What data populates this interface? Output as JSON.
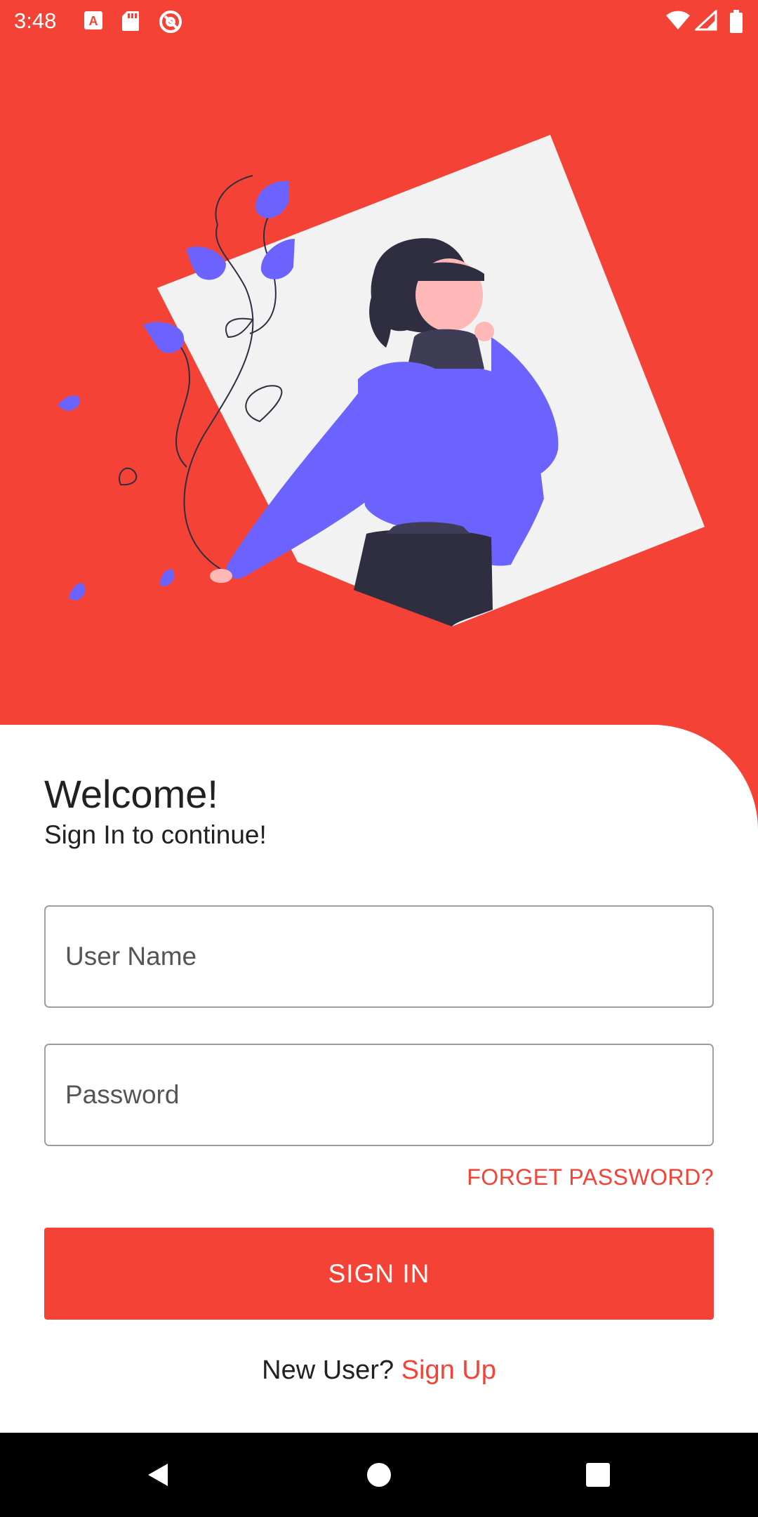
{
  "status_bar": {
    "time": "3:48",
    "left_icons": [
      "a-badge-icon",
      "sd-card-icon",
      "at-sign-icon"
    ],
    "right_icons": [
      "wifi-icon",
      "signal-icon",
      "battery-icon"
    ]
  },
  "colors": {
    "accent": "#F44336",
    "illustration_purple": "#6C63FF",
    "illustration_dark": "#2F2E41",
    "illustration_light": "#F2F2F2"
  },
  "login": {
    "title": "Welcome!",
    "subtitle": "Sign In to continue!",
    "username_placeholder": "User Name",
    "username_value": "",
    "password_placeholder": "Password",
    "password_value": "",
    "forgot_label": "FORGET PASSWORD?",
    "signin_label": "SIGN IN",
    "new_user_text": "New User?",
    "signup_label": "Sign Up"
  },
  "nav_bar": {
    "back": "back-icon",
    "home": "home-icon",
    "recents": "recents-icon"
  }
}
